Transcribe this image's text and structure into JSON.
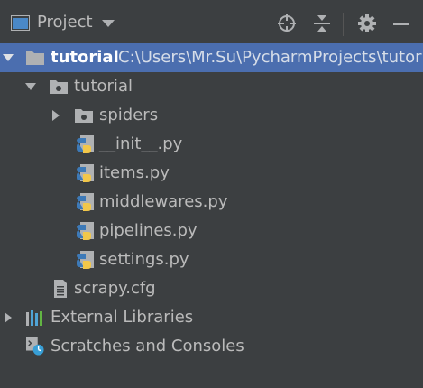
{
  "toolbar": {
    "title": "Project"
  },
  "tree": {
    "root": {
      "name": "tutorial",
      "path": "C:\\Users\\Mr.Su\\PycharmProjects\\tutorial"
    },
    "package": {
      "name": "tutorial"
    },
    "spiders": {
      "name": "spiders"
    },
    "files": [
      {
        "name": "__init__.py"
      },
      {
        "name": "items.py"
      },
      {
        "name": "middlewares.py"
      },
      {
        "name": "pipelines.py"
      },
      {
        "name": "settings.py"
      }
    ],
    "cfg": {
      "name": "scrapy.cfg"
    },
    "external": {
      "name": "External Libraries"
    },
    "scratches": {
      "name": "Scratches and Consoles"
    }
  },
  "colors": {
    "background": "#3c3f41",
    "selection": "#4b6eaf",
    "text": "#bbbbbb"
  }
}
